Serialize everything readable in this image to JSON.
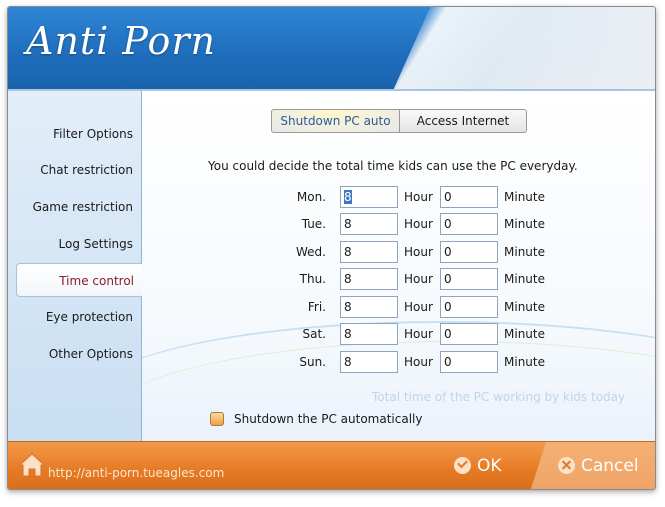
{
  "header": {
    "title": "Anti Porn",
    "brand_color": "#1f6fbe"
  },
  "sidebar": {
    "items": [
      {
        "label": "Filter Options"
      },
      {
        "label": "Chat restriction"
      },
      {
        "label": "Game restriction"
      },
      {
        "label": "Log Settings"
      },
      {
        "label": "Time control",
        "active": true
      },
      {
        "label": "Eye protection"
      },
      {
        "label": "Other Options"
      }
    ]
  },
  "tabs": [
    {
      "label": "Shutdown PC auto",
      "selected": true
    },
    {
      "label": "Access Internet",
      "selected": false
    }
  ],
  "description": "You could decide the total time kids can use the PC everyday.",
  "schedule": {
    "hour_unit": "Hour",
    "minute_unit": "Minute",
    "rows": [
      {
        "day": "Mon.",
        "hour": "8",
        "minute": "0"
      },
      {
        "day": "Tue.",
        "hour": "8",
        "minute": "0"
      },
      {
        "day": "Wed.",
        "hour": "8",
        "minute": "0"
      },
      {
        "day": "Thu.",
        "hour": "8",
        "minute": "0"
      },
      {
        "day": "Fri.",
        "hour": "8",
        "minute": "0"
      },
      {
        "day": "Sat.",
        "hour": "8",
        "minute": "0"
      },
      {
        "day": "Sun.",
        "hour": "8",
        "minute": "0"
      }
    ]
  },
  "total_label": "Total time of the PC working by kids today",
  "shutdown_checkbox": {
    "label": "Shutdown the PC automatically",
    "checked": false
  },
  "footer": {
    "url": "http://anti-porn.tueagles.com",
    "ok_label": "OK",
    "cancel_label": "Cancel",
    "accent_color": "#e57a24",
    "home_icon": "home-icon",
    "ok_icon": "check-icon",
    "cancel_icon": "x-icon"
  }
}
